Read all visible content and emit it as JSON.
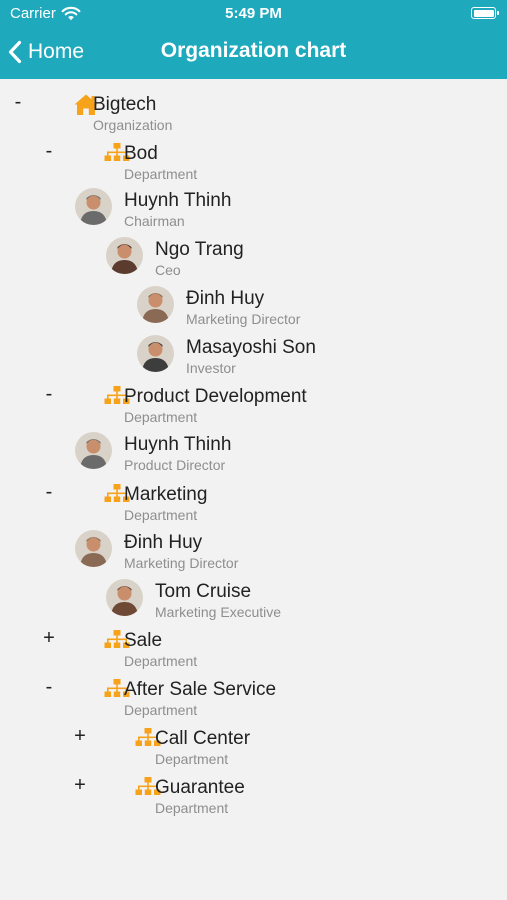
{
  "status_bar": {
    "carrier": "Carrier",
    "time": "5:49 PM"
  },
  "nav": {
    "back_label": "Home",
    "title": "Organization chart"
  },
  "colors": {
    "nav_bg": "#1fa9bd",
    "icon_orange": "#f7a21b",
    "background": "#f2f2f2"
  },
  "tree": [
    {
      "toggle": "-",
      "icon": "home-icon",
      "title": "Bigtech",
      "subtitle": "Organization"
    },
    {
      "toggle": "-",
      "icon": "org-chart-icon",
      "title": "Bod",
      "subtitle": "Department"
    },
    {
      "toggle": "",
      "icon": "avatar",
      "title": "Huynh Thinh",
      "subtitle": "Chairman"
    },
    {
      "toggle": "",
      "icon": "avatar",
      "title": "Ngo Trang",
      "subtitle": "Ceo"
    },
    {
      "toggle": "",
      "icon": "avatar",
      "title": "Đinh Huy",
      "subtitle": "Marketing Director"
    },
    {
      "toggle": "",
      "icon": "avatar",
      "title": "Masayoshi Son",
      "subtitle": "Investor"
    },
    {
      "toggle": "-",
      "icon": "org-chart-icon",
      "title": "Product Development",
      "subtitle": "Department"
    },
    {
      "toggle": "",
      "icon": "avatar",
      "title": "Huynh Thinh",
      "subtitle": "Product Director"
    },
    {
      "toggle": "-",
      "icon": "org-chart-icon",
      "title": "Marketing",
      "subtitle": "Department"
    },
    {
      "toggle": "",
      "icon": "avatar",
      "title": "Đinh Huy",
      "subtitle": "Marketing Director"
    },
    {
      "toggle": "",
      "icon": "avatar",
      "title": "Tom Cruise",
      "subtitle": "Marketing Executive"
    },
    {
      "toggle": "+",
      "icon": "org-chart-icon",
      "title": "Sale",
      "subtitle": "Department"
    },
    {
      "toggle": "-",
      "icon": "org-chart-icon",
      "title": "After Sale Service",
      "subtitle": "Department"
    },
    {
      "toggle": "+",
      "icon": "org-chart-icon",
      "title": "Call Center",
      "subtitle": "Department"
    },
    {
      "toggle": "+",
      "icon": "org-chart-icon",
      "title": "Guarantee",
      "subtitle": "Department"
    }
  ]
}
